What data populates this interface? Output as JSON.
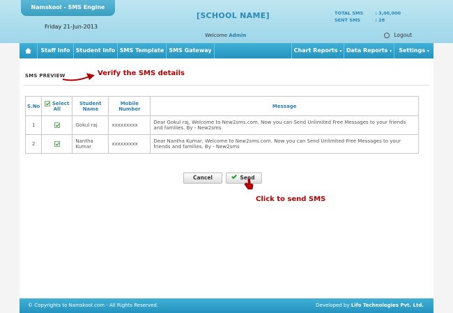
{
  "header": {
    "brand": "Namskool - SMS Engine",
    "date": "Friday 21-Jun-2013",
    "school_name": "[SCHOOL NAME]",
    "welcome_prefix": "Welcome",
    "welcome_user": "Admin",
    "stats": [
      {
        "label": "TOTAL SMS",
        "value": ": 3,00,000"
      },
      {
        "label": "SENT SMS",
        "value": ": 28"
      }
    ],
    "logout_label": "Logout"
  },
  "nav": {
    "items": [
      {
        "label": "Staff Info"
      },
      {
        "label": "Student Info"
      },
      {
        "label": "SMS Template"
      },
      {
        "label": "SMS Gateway"
      }
    ],
    "right_items": [
      {
        "label": "Chart Reports"
      },
      {
        "label": "Data Reports"
      },
      {
        "label": "Settings"
      }
    ],
    "caret": "▾"
  },
  "main": {
    "section_title": "SMS PREVIEW",
    "annotation_verify": "Verify the SMS details",
    "table": {
      "headers": [
        "S.No",
        "Select All",
        "Student Name",
        "Mobile Number",
        "Message"
      ],
      "rows": [
        {
          "sno": "1",
          "name": "Gokul raj",
          "mobile": "xxxxxxxxx",
          "message": "Dear Gokul raj, Welcome to New2sms.com. Now you can Send Unlimited Free Messages to your friends and families. By - New2sms"
        },
        {
          "sno": "2",
          "name": "Nantha Kumar",
          "mobile": "xxxxxxxxx",
          "message": "Dear Nantha Kumar, Welcome to New2sms.com. Now you can Send Unlimited Free Messages to your friends and families. By - New2sms"
        }
      ]
    },
    "cancel_label": "Cancel",
    "send_label": "Send",
    "annotation_send": "Click to send SMS"
  },
  "footer": {
    "copyright": "© Copyrights to Namskool.com - All Rights Reserved.",
    "developed_prefix": "Developed by",
    "developer": "Lifo Technologies Pvt. Ltd."
  },
  "colors": {
    "header_bg": "#a9dcec",
    "nav_bg": "#2593bf",
    "accent_blue": "#2a88b5",
    "annotation_red": "#b40000"
  }
}
